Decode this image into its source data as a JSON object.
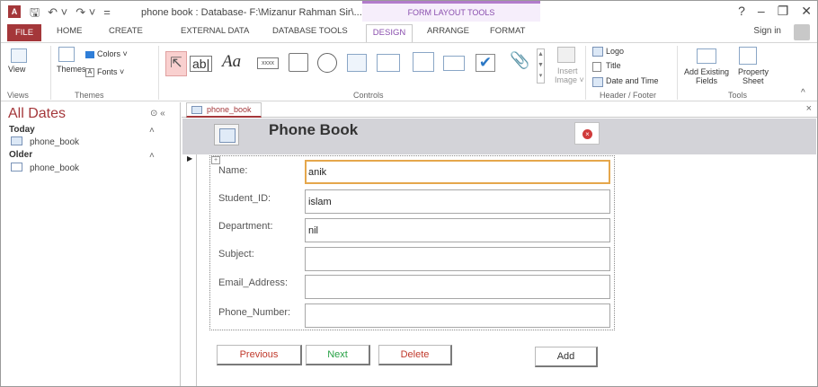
{
  "app": {
    "quick_access": [
      "↶ ˅",
      "↷ ˅",
      "="
    ],
    "document_title": "phone book : Database- F:\\Mizanur Rahman Sir\\...",
    "context_group": "FORM LAYOUT TOOLS",
    "window_controls": [
      "?",
      "–",
      "❐",
      "✕"
    ],
    "sign_in": "Sign in"
  },
  "ribbon": {
    "tabs": [
      "FILE",
      "HOME",
      "CREATE",
      "EXTERNAL DATA",
      "DATABASE TOOLS",
      "DESIGN",
      "ARRANGE",
      "FORMAT"
    ],
    "views_group": {
      "view_label": "View",
      "group_label": "Views"
    },
    "themes_group": {
      "themes_label": "Themes",
      "colors_label": "Colors ˅",
      "fonts_label": "Fonts ˅",
      "group_label": "Themes"
    },
    "controls_group": {
      "group_label": "Controls",
      "text_box": "ab|",
      "label_control": "Aa",
      "button": "xxxx"
    },
    "insert_image": {
      "line1": "Insert",
      "line2": "Image ˅"
    },
    "header_footer": {
      "logo": "Logo",
      "title": "Title",
      "date_time": "Date and Time",
      "group_label": "Header / Footer"
    },
    "tools": {
      "add_existing_line1": "Add Existing",
      "add_existing_line2": "Fields",
      "property_line1": "Property",
      "property_line2": "Sheet",
      "group_label": "Tools"
    },
    "collapse": "^"
  },
  "nav_pane": {
    "title": "All Dates",
    "controls": "⊙  «",
    "groups": [
      {
        "name": "Today",
        "chevron": "˄",
        "items": [
          "phone_book"
        ]
      },
      {
        "name": "Older",
        "chevron": "˄",
        "items": [
          "phone_book"
        ]
      }
    ]
  },
  "document": {
    "tab_label": "phone_book",
    "close": "×",
    "form_title": "Phone Book",
    "close_glyph": "×",
    "layout_selector": "+",
    "record_indicator": "▶",
    "fields": [
      {
        "label": "Name:",
        "value": "anik"
      },
      {
        "label": "Student_ID:",
        "value": "islam"
      },
      {
        "label": "Department:",
        "value": "nil"
      },
      {
        "label": "Subject:",
        "value": ""
      },
      {
        "label": "Email_Address:",
        "value": ""
      },
      {
        "label": "Phone_Number:",
        "value": ""
      }
    ],
    "buttons": {
      "previous": "Previous",
      "next": "Next",
      "delete": "Delete",
      "add": "Add"
    }
  },
  "colors": {
    "access_accent": "#a4373a",
    "context_purple": "#8a4fae",
    "active_field_border": "#e5a74c",
    "previous_text": "#c0392b",
    "next_text": "#27a145",
    "delete_text": "#c0392b",
    "add_text": "#333333"
  }
}
